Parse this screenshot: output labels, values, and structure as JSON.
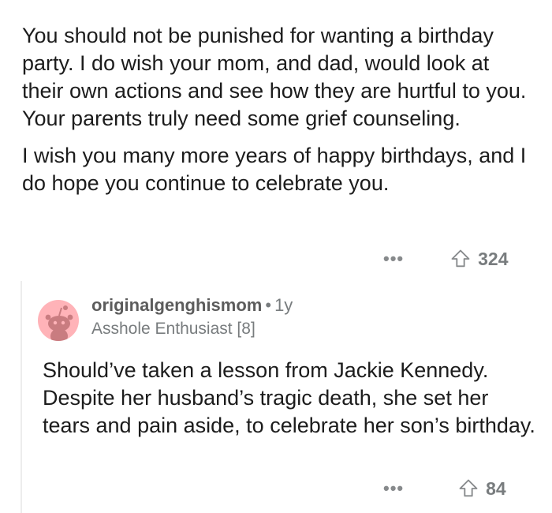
{
  "comment1": {
    "paragraphs": [
      "You should not be punished for wanting a birthday party. I do wish your mom, and dad, would look at their own actions and see how they are hurtful to you. Your parents truly need some grief counseling.",
      "I wish you many more years of happy birthdays, and I do hope you continue to celebrate you."
    ],
    "more_label": "•••",
    "votes": "324"
  },
  "reply": {
    "username": "originalgenghismom",
    "separator": "•",
    "age": "1y",
    "flair": "Asshole Enthusiast [8]",
    "text": "Should’ve taken a lesson from Jackie Kennedy. Despite her husband’s tragic death, she set her tears and pain aside, to celebrate her son’s birthday.",
    "more_label": "•••",
    "votes": "84"
  },
  "colors": {
    "avatar_bg": "#ffb3b8",
    "avatar_fg": "#c97c80",
    "meta_grey": "#878a8c"
  },
  "icons": [
    "more-options-icon",
    "upvote-icon",
    "snoo-avatar-icon"
  ]
}
